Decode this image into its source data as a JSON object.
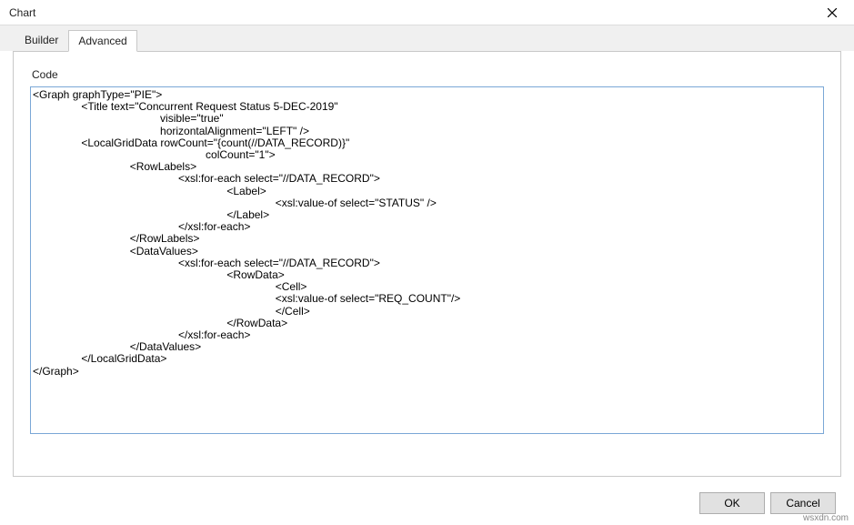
{
  "window": {
    "title": "Chart"
  },
  "tabs": {
    "builder": "Builder",
    "advanced": "Advanced"
  },
  "panel": {
    "label": "Code",
    "code": "<Graph graphType=\"PIE\">\n                <Title text=\"Concurrent Request Status 5-DEC-2019\"\n                                          visible=\"true\"\n                                          horizontalAlignment=\"LEFT\" />\n                <LocalGridData rowCount=\"{count(//DATA_RECORD)}\"\n                                                         colCount=\"1\">\n                                <RowLabels>\n                                                <xsl:for-each select=\"//DATA_RECORD\">\n                                                                <Label>\n                                                                                <xsl:value-of select=\"STATUS\" />\n                                                                </Label>\n                                                </xsl:for-each>\n                                </RowLabels>\n                                <DataValues>\n                                                <xsl:for-each select=\"//DATA_RECORD\">\n                                                                <RowData>\n                                                                                <Cell>\n                                                                                <xsl:value-of select=\"REQ_COUNT\"/>\n                                                                                </Cell>\n                                                                </RowData>\n                                                </xsl:for-each>\n                                </DataValues>\n                </LocalGridData>\n</Graph>"
  },
  "buttons": {
    "ok": "OK",
    "cancel": "Cancel"
  },
  "watermark": "wsxdn.com"
}
